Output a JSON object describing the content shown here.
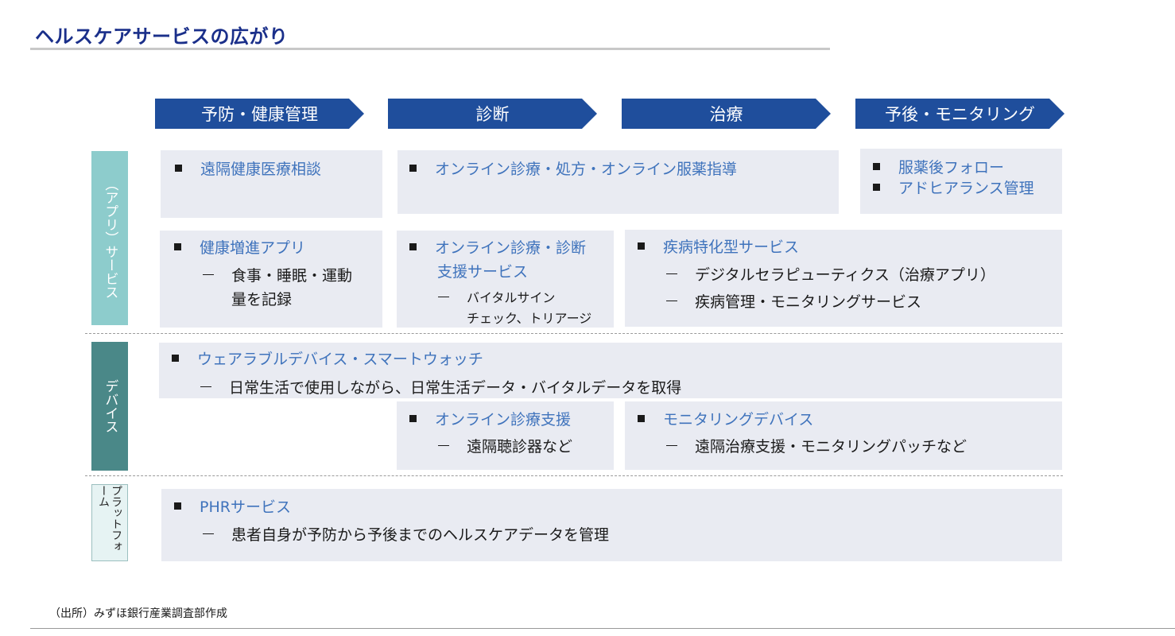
{
  "title": "ヘルスケアサービスの広がり",
  "phases": [
    "予防・健康管理",
    "診断",
    "治療",
    "予後・モニタリング"
  ],
  "categories": {
    "app": "（アプリ）サービス",
    "device": "デバイス",
    "platform": "プラットフォーム"
  },
  "boxes": {
    "remote_consult": {
      "item": "遠隔健康医療相談"
    },
    "online_rx": {
      "item": "オンライン診療・処方・オンライン服薬指導"
    },
    "post_med": {
      "item1": "服薬後フォロー",
      "item2": "アドヒアランス管理"
    },
    "health_app": {
      "item": "健康増進アプリ",
      "sub_line1": "食事・睡眠・運動",
      "sub_line2": "量を記録"
    },
    "online_support": {
      "item_line1": "オンライン診療・診断",
      "item_line2": "支援サービス",
      "sub_line1": "バイタルサイン",
      "sub_line2": "チェック、トリアージ"
    },
    "disease_specific": {
      "item": "疾病特化型サービス",
      "sub1": "デジタルセラピューティクス（治療アプリ）",
      "sub2": "疾病管理・モニタリングサービス"
    },
    "wearable": {
      "item": "ウェアラブルデバイス・スマートウォッチ",
      "sub": "日常生活で使用しながら、日常生活データ・バイタルデータを取得"
    },
    "online_device": {
      "item": "オンライン診療支援",
      "sub": "遠隔聴診器など"
    },
    "monitoring_device": {
      "item": "モニタリングデバイス",
      "sub": "遠隔治療支援・モニタリングパッチなど"
    },
    "phr": {
      "item": "PHRサービス",
      "sub": "患者自身が予防から予後までのヘルスケアデータを管理"
    }
  },
  "source": "（出所）みずほ銀行産業調査部作成"
}
